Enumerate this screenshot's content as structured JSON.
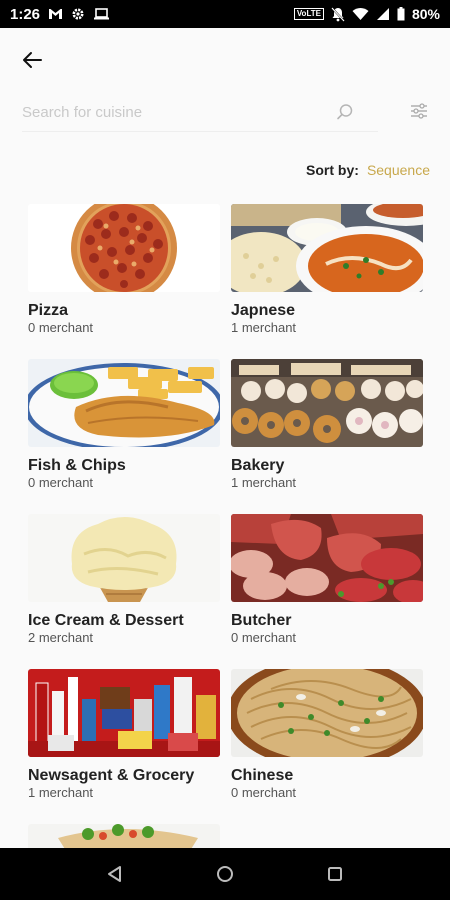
{
  "status_bar": {
    "time": "1:26",
    "volte": "VoLTE",
    "battery": "80%"
  },
  "search": {
    "placeholder": "Search for cuisine",
    "value": ""
  },
  "sort": {
    "label": "Sort by:",
    "value": "Sequence"
  },
  "colors": {
    "accent": "#c8a84c",
    "background": "#fafafa"
  },
  "cuisines": [
    {
      "name": "Pizza",
      "count": "0 merchant",
      "image": "pizza"
    },
    {
      "name": "Japnese",
      "count": "1 merchant",
      "image": "curry"
    },
    {
      "name": "Fish & Chips",
      "count": "0 merchant",
      "image": "fish-chips"
    },
    {
      "name": "Bakery",
      "count": "1 merchant",
      "image": "bakery"
    },
    {
      "name": "Ice Cream & Dessert",
      "count": "2 merchant",
      "image": "ice-cream"
    },
    {
      "name": "Butcher",
      "count": "0 merchant",
      "image": "meat"
    },
    {
      "name": "Newsagent & Grocery",
      "count": "1 merchant",
      "image": "grocery"
    },
    {
      "name": "Chinese",
      "count": "0 merchant",
      "image": "noodles"
    },
    {
      "name": "",
      "count": "",
      "image": "wrap"
    }
  ]
}
